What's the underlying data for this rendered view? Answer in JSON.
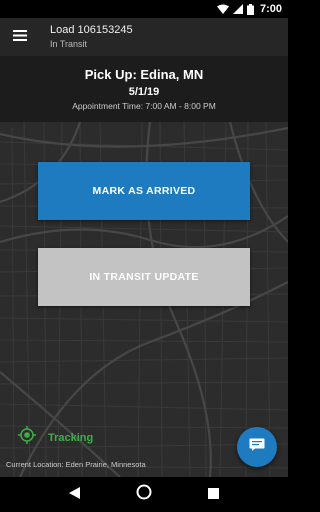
{
  "status_bar": {
    "time": "7:00"
  },
  "header": {
    "title": "Load 106153245",
    "subtitle": "In Transit"
  },
  "pickup": {
    "title": "Pick Up: Edina, MN",
    "date": "5/1/19",
    "appointment": "Appointment Time: 7:00 AM - 8:00 PM"
  },
  "actions": {
    "mark_arrived": "MARK AS ARRIVED",
    "in_transit_update": "IN TRANSIT UPDATE"
  },
  "tracking": {
    "label": "Tracking"
  },
  "location": {
    "current": "Current Location: Eden Prairie, Minnesota"
  },
  "colors": {
    "accent": "#1f7bbf",
    "tracking": "#3fae49",
    "disabled_button": "#c3c3c3"
  }
}
